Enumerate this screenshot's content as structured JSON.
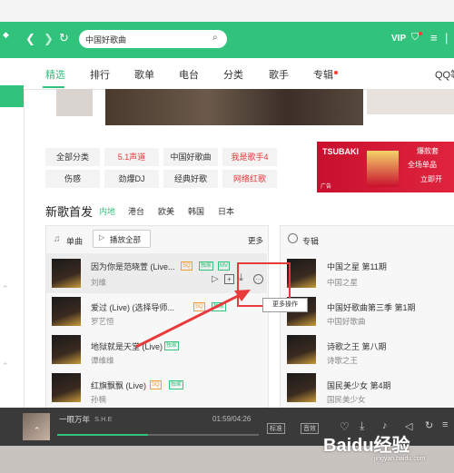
{
  "search": {
    "value": "中国好歌曲"
  },
  "header": {
    "vip": "VIP"
  },
  "tabs": [
    {
      "label": "精选"
    },
    {
      "label": "排行"
    },
    {
      "label": "歌单"
    },
    {
      "label": "电台"
    },
    {
      "label": "分类"
    },
    {
      "label": "歌手"
    },
    {
      "label": "专辑"
    },
    {
      "label": "QQ等"
    }
  ],
  "categories": {
    "row1": [
      "全部分类",
      "5.1声道",
      "中国好歌曲",
      "我是歌手4"
    ],
    "row2": [
      "伤感",
      "劲爆DJ",
      "经典好歌",
      "网络红歌"
    ]
  },
  "ad": {
    "brand": "TSUBAKI",
    "text1": "爆款套",
    "text2": "全场单品",
    "text3": "立即开",
    "label": "广告"
  },
  "new_songs": {
    "title": "新歌首发",
    "regions": [
      "内地",
      "港台",
      "欧美",
      "韩国",
      "日本"
    ]
  },
  "singles": {
    "title": "单曲",
    "play_all": "播放全部",
    "more": "更多",
    "songs": [
      {
        "title": "因为你是范晓萱 (Live...",
        "artist": "刘维",
        "tags": [
          "SQ",
          "独家",
          "MV"
        ]
      },
      {
        "title": "爱过 (Live) (选择导师...",
        "artist": "罗艺恒",
        "tags": [
          "SQ",
          "独家"
        ]
      },
      {
        "title": "地狱就是天堂 (Live)",
        "artist": "谭维维",
        "tags": [
          "独家"
        ]
      },
      {
        "title": "红旗飘飘 (Live)",
        "artist": "孙楠",
        "tags": [
          "SQ",
          "独家"
        ]
      }
    ],
    "tooltip": "更多操作"
  },
  "albums": {
    "title": "专辑",
    "items": [
      {
        "title": "中国之星 第11期",
        "artist": "中国之星"
      },
      {
        "title": "中国好歌曲第三季 第1期",
        "artist": "中国好歌曲"
      },
      {
        "title": "诗歌之王 第八期",
        "artist": "诗歌之王"
      },
      {
        "title": "国民美少女 第4期",
        "artist": "国民美少女"
      }
    ]
  },
  "player": {
    "track": "一眼万年",
    "artist": "S.H.E",
    "time": "01:59/04:26",
    "quality": "标准",
    "sound": "音效"
  },
  "progress": {
    "fraction": 0.45
  },
  "watermark": {
    "text": "Baidu经验",
    "url": "jingyan.baidu.com"
  },
  "colors": {
    "brand": "#31c27c",
    "annotation": "#e83a3a"
  }
}
